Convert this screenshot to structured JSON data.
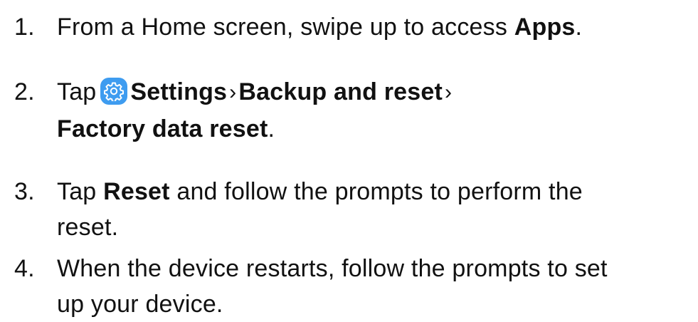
{
  "steps": [
    {
      "number": "1.",
      "text_before": "From a Home screen, swipe up to access ",
      "bold": "Apps",
      "text_after": "."
    },
    {
      "number": "2.",
      "text_before": "Tap",
      "icon": "settings-gear-icon",
      "bold_settings": "Settings",
      "separator": "›",
      "bold_backup": "Backup and reset",
      "bold_factory": "Factory data reset",
      "text_after": "."
    },
    {
      "number": "3.",
      "text_before": "Tap ",
      "bold": "Reset",
      "text_after_line1": " and follow the prompts to perform the",
      "text_line2": "reset."
    },
    {
      "number": "4.",
      "text_line1": "When the device restarts, follow the prompts to set",
      "text_line2": "up your device."
    }
  ],
  "colors": {
    "text": "#111111",
    "icon_background": "#3e9cf0",
    "icon_foreground": "#ffffff"
  }
}
